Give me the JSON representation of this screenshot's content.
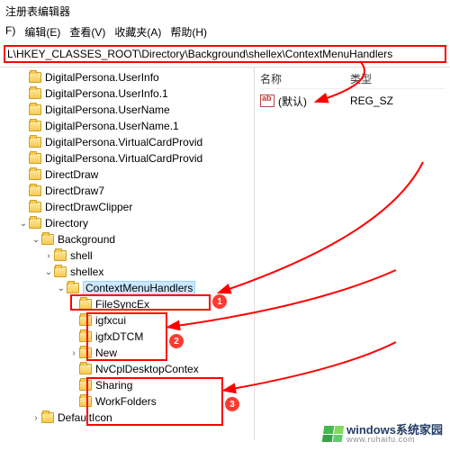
{
  "window": {
    "title": "注册表编辑器"
  },
  "menu": {
    "file": "编辑(E)",
    "view": "查看(V)",
    "fav": "收藏夹(A)",
    "help": "帮助(H)",
    "f_label": "F)"
  },
  "path": "L\\HKEY_CLASSES_ROOT\\Directory\\Background\\shellex\\ContextMenuHandlers",
  "tree": [
    {
      "lvl": 1,
      "tw": "",
      "label": "DigitalPersona.UserInfo"
    },
    {
      "lvl": 1,
      "tw": "",
      "label": "DigitalPersona.UserInfo.1"
    },
    {
      "lvl": 1,
      "tw": "",
      "label": "DigitalPersona.UserName"
    },
    {
      "lvl": 1,
      "tw": "",
      "label": "DigitalPersona.UserName.1"
    },
    {
      "lvl": 1,
      "tw": "",
      "label": "DigitalPersona.VirtualCardProvid"
    },
    {
      "lvl": 1,
      "tw": "",
      "label": "DigitalPersona.VirtualCardProvid"
    },
    {
      "lvl": 1,
      "tw": "",
      "label": "DirectDraw"
    },
    {
      "lvl": 1,
      "tw": "",
      "label": "DirectDraw7"
    },
    {
      "lvl": 1,
      "tw": "",
      "label": "DirectDrawClipper"
    },
    {
      "lvl": 1,
      "tw": "v",
      "label": "Directory"
    },
    {
      "lvl": 2,
      "tw": "v",
      "label": "Background"
    },
    {
      "lvl": 3,
      "tw": ">",
      "label": "shell"
    },
    {
      "lvl": 3,
      "tw": "v",
      "label": "shellex"
    },
    {
      "lvl": 4,
      "tw": "v",
      "label": "ContextMenuHandlers",
      "sel": true
    },
    {
      "lvl": 5,
      "tw": "",
      "label": "FileSyncEx"
    },
    {
      "lvl": 5,
      "tw": "",
      "label": "igfxcui"
    },
    {
      "lvl": 5,
      "tw": "",
      "label": "igfxDTCM"
    },
    {
      "lvl": 5,
      "tw": ">",
      "label": "New"
    },
    {
      "lvl": 5,
      "tw": "",
      "label": "NvCplDesktopContex"
    },
    {
      "lvl": 5,
      "tw": "",
      "label": "Sharing"
    },
    {
      "lvl": 5,
      "tw": "",
      "label": "WorkFolders"
    },
    {
      "lvl": 2,
      "tw": ">",
      "label": "DefaultIcon"
    }
  ],
  "list": {
    "col_name": "名称",
    "col_type": "类型",
    "rows": [
      {
        "name": "(默认)",
        "type": "REG_SZ"
      }
    ]
  },
  "annotations": {
    "path_box": true,
    "badges": [
      "1",
      "2",
      "3"
    ]
  },
  "watermark": {
    "main": "windows系统家园",
    "sub": "www.ruhaifu.com"
  }
}
